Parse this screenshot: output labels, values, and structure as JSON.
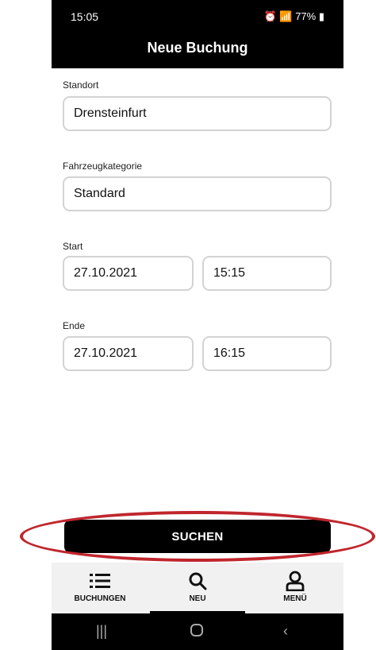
{
  "status": {
    "time": "15:05",
    "right": "77%"
  },
  "header": {
    "title": "Neue Buchung"
  },
  "form": {
    "location_label": "Standort",
    "location_value": "Drensteinfurt",
    "category_label": "Fahrzeugkategorie",
    "category_value": "Standard",
    "start_label": "Start",
    "start_date": "27.10.2021",
    "start_time": "15:15",
    "end_label": "Ende",
    "end_date": "27.10.2021",
    "end_time": "16:15"
  },
  "actions": {
    "search_label": "SUCHEN"
  },
  "nav": {
    "items": [
      {
        "label": "BUCHUNGEN",
        "icon": "list-icon"
      },
      {
        "label": "NEU",
        "icon": "search-icon"
      },
      {
        "label": "MENÜ",
        "icon": "user-icon"
      }
    ],
    "active": "NEU"
  },
  "colors": {
    "highlight": "#c0262d",
    "header_bg": "#000000",
    "nav_bg": "#f1f1f1"
  }
}
